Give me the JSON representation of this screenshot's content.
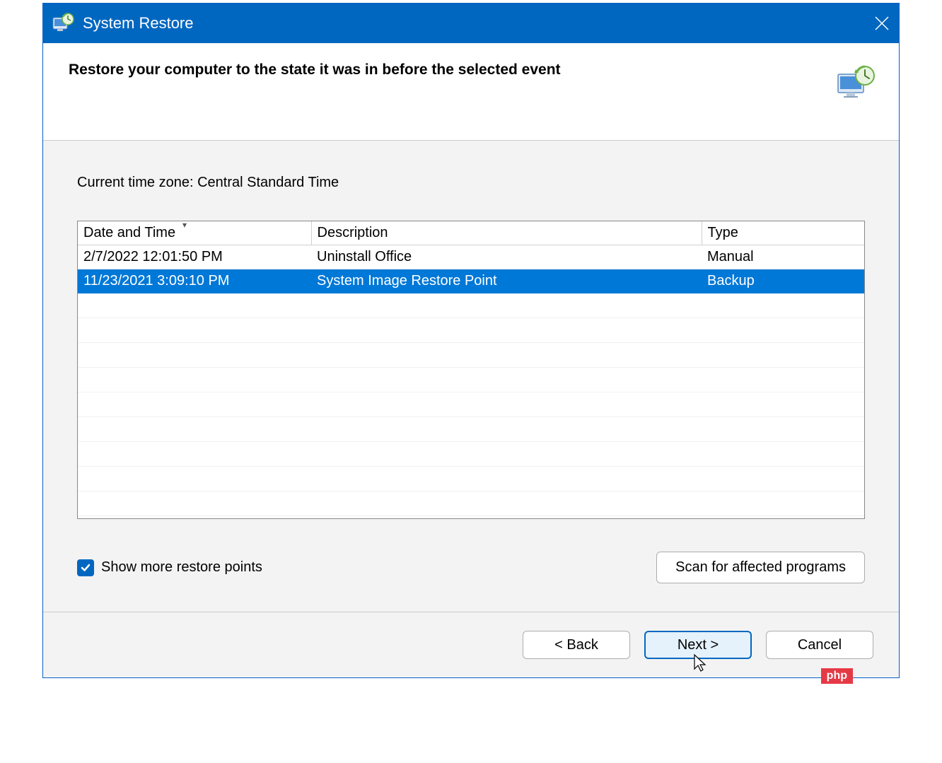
{
  "window": {
    "title": "System Restore"
  },
  "header": {
    "heading": "Restore your computer to the state it was in before the selected event"
  },
  "content": {
    "timezone_label": "Current time zone: Central Standard Time"
  },
  "table": {
    "columns": {
      "date": "Date and Time",
      "description": "Description",
      "type": "Type"
    },
    "rows": [
      {
        "date": "2/7/2022 12:01:50 PM",
        "description": "Uninstall Office",
        "type": "Manual",
        "selected": false
      },
      {
        "date": "11/23/2021 3:09:10 PM",
        "description": "System Image Restore Point",
        "type": "Backup",
        "selected": true
      }
    ]
  },
  "controls": {
    "show_more_label": "Show more restore points",
    "show_more_checked": true,
    "scan_label": "Scan for affected programs"
  },
  "footer": {
    "back": "< Back",
    "next": "Next >",
    "cancel": "Cancel"
  },
  "watermark": "php"
}
